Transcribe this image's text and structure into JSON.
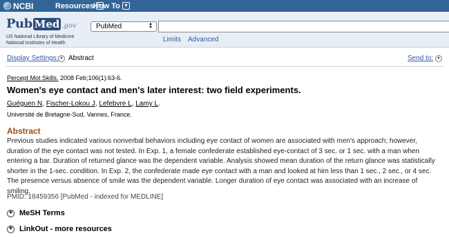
{
  "topbar": {
    "ncbi_label": "NCBI",
    "menus": [
      {
        "label": "Resources"
      },
      {
        "label": "How To"
      }
    ]
  },
  "header": {
    "logo": {
      "pub": "Pub",
      "med": "Med",
      "gov": ".gov"
    },
    "nlm_line1": "US National Library of Medicine",
    "nlm_line2": "National Institutes of Health",
    "database": "PubMed",
    "search_value": "",
    "links": {
      "limits": "Limits",
      "advanced": "Advanced"
    }
  },
  "display": {
    "settings_label": "Display Settings:",
    "format": "Abstract",
    "send_to": "Send to:"
  },
  "article": {
    "journal": "Percept Mot Skills.",
    "citation_rest": " 2008 Feb;106(1):63-6.",
    "title": "Women's eye contact and men's later interest: two field experiments.",
    "authors": [
      "Guéguen N",
      "Fischer-Lokou J",
      "Lefebvre L",
      "Lamy L"
    ],
    "author_seps": [
      ", ",
      ", ",
      ", ",
      "."
    ],
    "affiliation": "Université de Bretagne-Sud, Vannes, France.",
    "abstract_heading": "Abstract",
    "abstract_text": "Previous studies indicated various nonverbal behaviors including eye contact of women are associated with men's approach; however, duration of the eye contact was not tested. In Exp. 1, a female confederate established eye-contact of 3 sec. or 1 sec. with a man when entering a bar. Duration of returned glance was the dependent variable. Analysis showed mean duration of the return glance was statistically shorter in the 1-sec. condition. In Exp. 2, the confederate made eye contact with a man and looked at him less than 1 sec., 2 sec., or 4 sec. The presence versus absence of smile was the dependent variable. Longer duration of eye contact was associated with an increase of smiling.",
    "pmid": "PMID: 18459356 [PubMed - indexed for MEDLINE]"
  },
  "sections": [
    {
      "label": "MeSH Terms"
    },
    {
      "label": "LinkOut - more resources"
    }
  ]
}
